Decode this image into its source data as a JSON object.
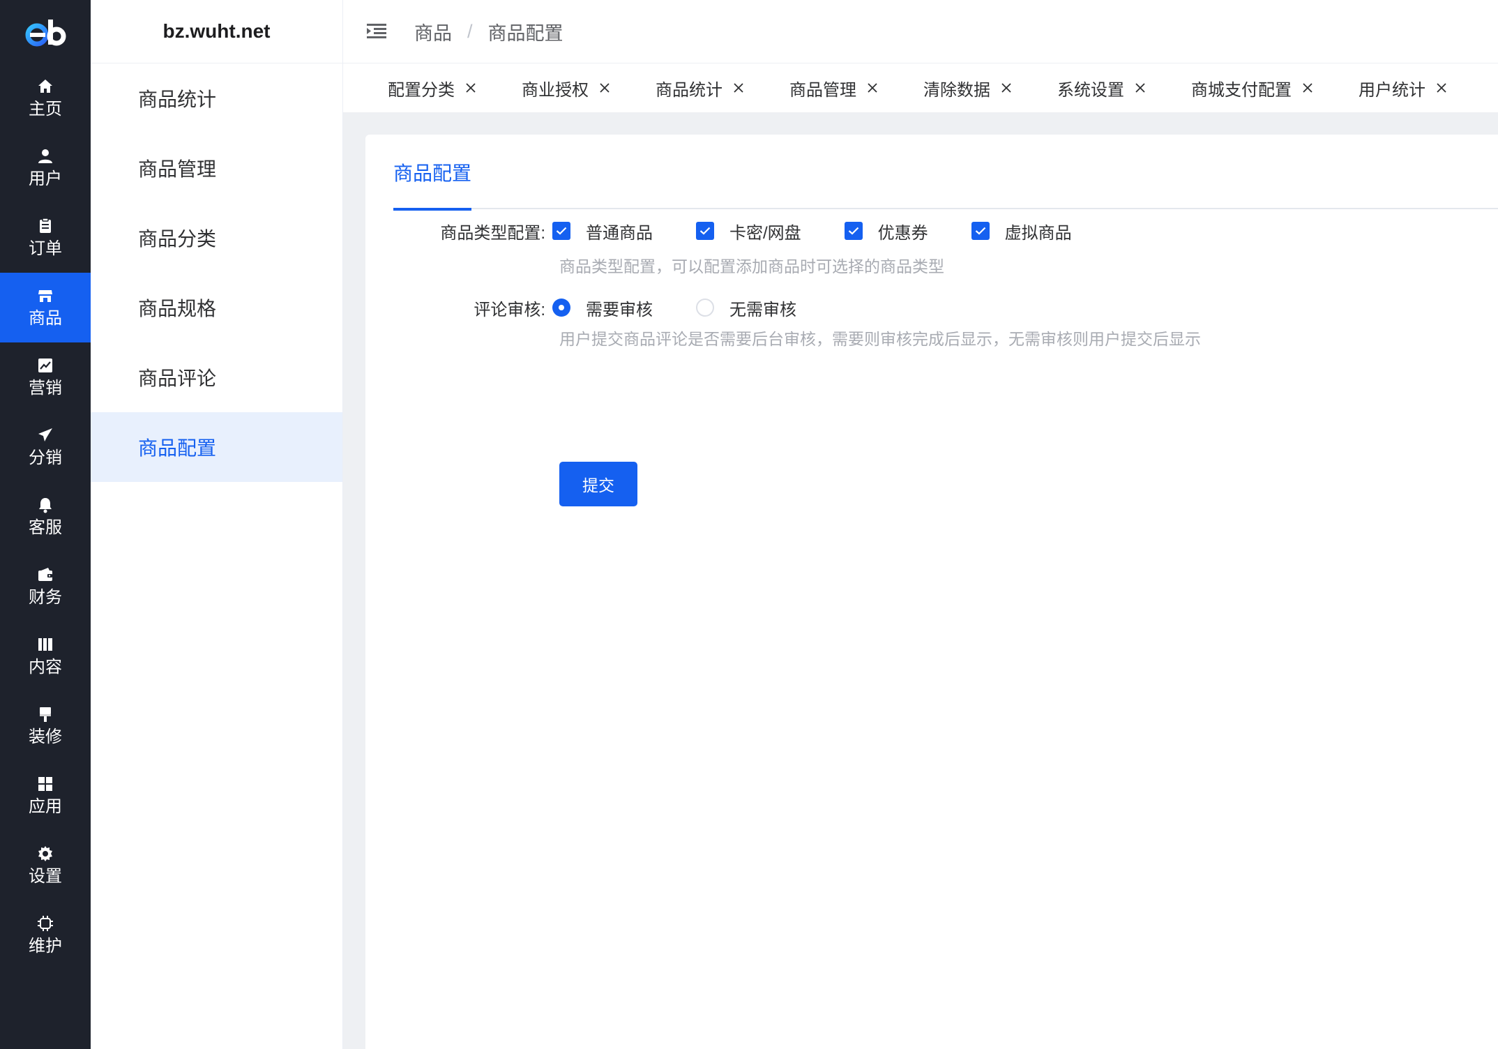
{
  "rail": {
    "items": [
      {
        "label": "主页",
        "icon": "home-icon"
      },
      {
        "label": "用户",
        "icon": "user-icon"
      },
      {
        "label": "订单",
        "icon": "clipboard-icon"
      },
      {
        "label": "商品",
        "icon": "shop-icon"
      },
      {
        "label": "营销",
        "icon": "chart-icon"
      },
      {
        "label": "分销",
        "icon": "send-icon"
      },
      {
        "label": "客服",
        "icon": "bell-icon"
      },
      {
        "label": "财务",
        "icon": "wallet-icon"
      },
      {
        "label": "内容",
        "icon": "book-icon"
      },
      {
        "label": "装修",
        "icon": "brush-icon"
      },
      {
        "label": "应用",
        "icon": "grid-icon"
      },
      {
        "label": "设置",
        "icon": "gear-icon"
      },
      {
        "label": "维护",
        "icon": "chip-icon"
      }
    ],
    "active_index": 3,
    "accent": "#1560f0",
    "bg": "#1e222c"
  },
  "sidebar": {
    "title": "bz.wuht.net",
    "items": [
      "商品统计",
      "商品管理",
      "商品分类",
      "商品规格",
      "商品评论",
      "商品配置"
    ],
    "active_index": 5
  },
  "header": {
    "breadcrumb": [
      "商品",
      "商品配置"
    ],
    "separator": "/"
  },
  "tabs": [
    "配置分类",
    "商业授权",
    "商品统计",
    "商品管理",
    "清除数据",
    "系统设置",
    "商城支付配置",
    "用户统计"
  ],
  "card": {
    "tab_label": "商品配置",
    "product_type": {
      "label": "商品类型配置:",
      "options": [
        "普通商品",
        "卡密/网盘",
        "优惠券",
        "虚拟商品"
      ],
      "checked": [
        true,
        true,
        true,
        true
      ],
      "help": "商品类型配置，可以配置添加商品时可选择的商品类型"
    },
    "review": {
      "label": "评论审核:",
      "options": [
        "需要审核",
        "无需审核"
      ],
      "selected": 0,
      "help": "用户提交商品评论是否需要后台审核，需要则审核完成后显示，无需审核则用户提交后显示"
    },
    "submit_label": "提交"
  }
}
